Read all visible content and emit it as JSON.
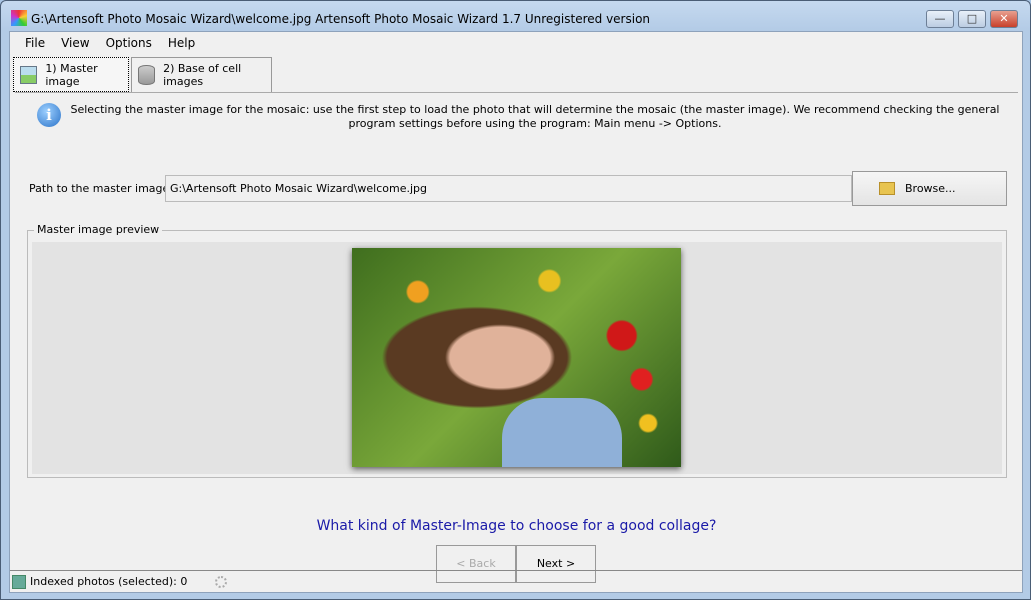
{
  "window": {
    "title": "G:\\Artensoft Photo Mosaic Wizard\\welcome.jpg Artensoft Photo Mosaic Wizard 1.7  Unregistered version",
    "minimize": "—",
    "maximize": "□",
    "close": "✕"
  },
  "menu": [
    "File",
    "View",
    "Options",
    "Help"
  ],
  "tabs": [
    {
      "label": "1) Master image",
      "icon": "image-icon"
    },
    {
      "label": "2) Base of cell images",
      "icon": "database-add-icon"
    }
  ],
  "info": {
    "icon": "info-icon",
    "text": "Selecting the master image for the mosaic: use the first step to load the photo that will determine the mosaic (the master image). We recommend checking the general program settings before using the program: Main menu -> Options."
  },
  "path": {
    "label": "Path to the master image:",
    "value": "G:\\Artensoft Photo Mosaic Wizard\\welcome.jpg",
    "browse": "Browse..."
  },
  "preview": {
    "label": "Master image preview"
  },
  "question": "What kind of Master-Image to choose for a good collage?",
  "nav": {
    "back": "< Back",
    "next": "Next >",
    "back_enabled": false
  },
  "status": {
    "text": "Indexed photos (selected): 0"
  }
}
